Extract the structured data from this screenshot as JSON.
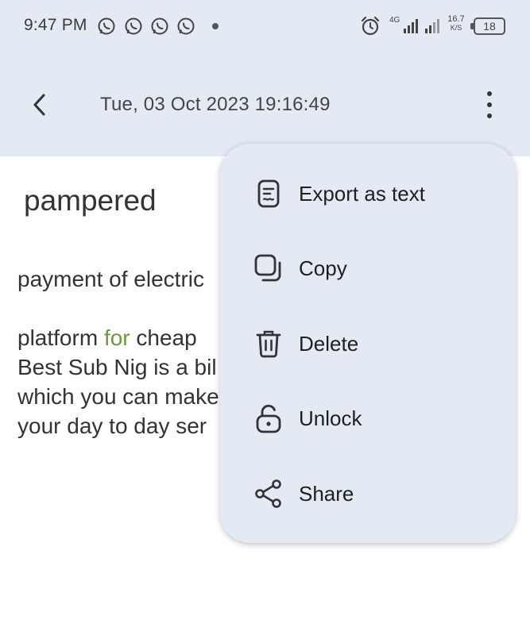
{
  "status_bar": {
    "time": "9:47 PM",
    "notification_icons": [
      "whatsapp-icon",
      "whatsapp-icon",
      "whatsapp-icon",
      "whatsapp-icon"
    ],
    "network": "4G",
    "speed_value": "16.7",
    "speed_unit": "K/S",
    "battery": "18"
  },
  "header": {
    "date": "Tue, 03 Oct 2023 19:16:49",
    "back_icon": "chevron-left-icon",
    "more_icon": "more-vertical-icon"
  },
  "note": {
    "title": "pampered",
    "body_line1": "payment of electric",
    "body_line2_a": "platform ",
    "body_line2_b": "for",
    "body_line2_c": " cheap",
    "body_line3": "Best Sub Nig is a bil",
    "body_line4": "which you can make",
    "body_line5": "your day to day ser"
  },
  "menu": {
    "items": [
      {
        "label": "Export as text",
        "icon": "document-text-icon"
      },
      {
        "label": "Copy",
        "icon": "copy-icon"
      },
      {
        "label": "Delete",
        "icon": "trash-icon"
      },
      {
        "label": "Unlock",
        "icon": "unlock-icon"
      },
      {
        "label": "Share",
        "icon": "share-icon"
      }
    ]
  },
  "colors": {
    "header_bg": "#e3eaf3",
    "highlight_green": "#6a9a3a"
  }
}
